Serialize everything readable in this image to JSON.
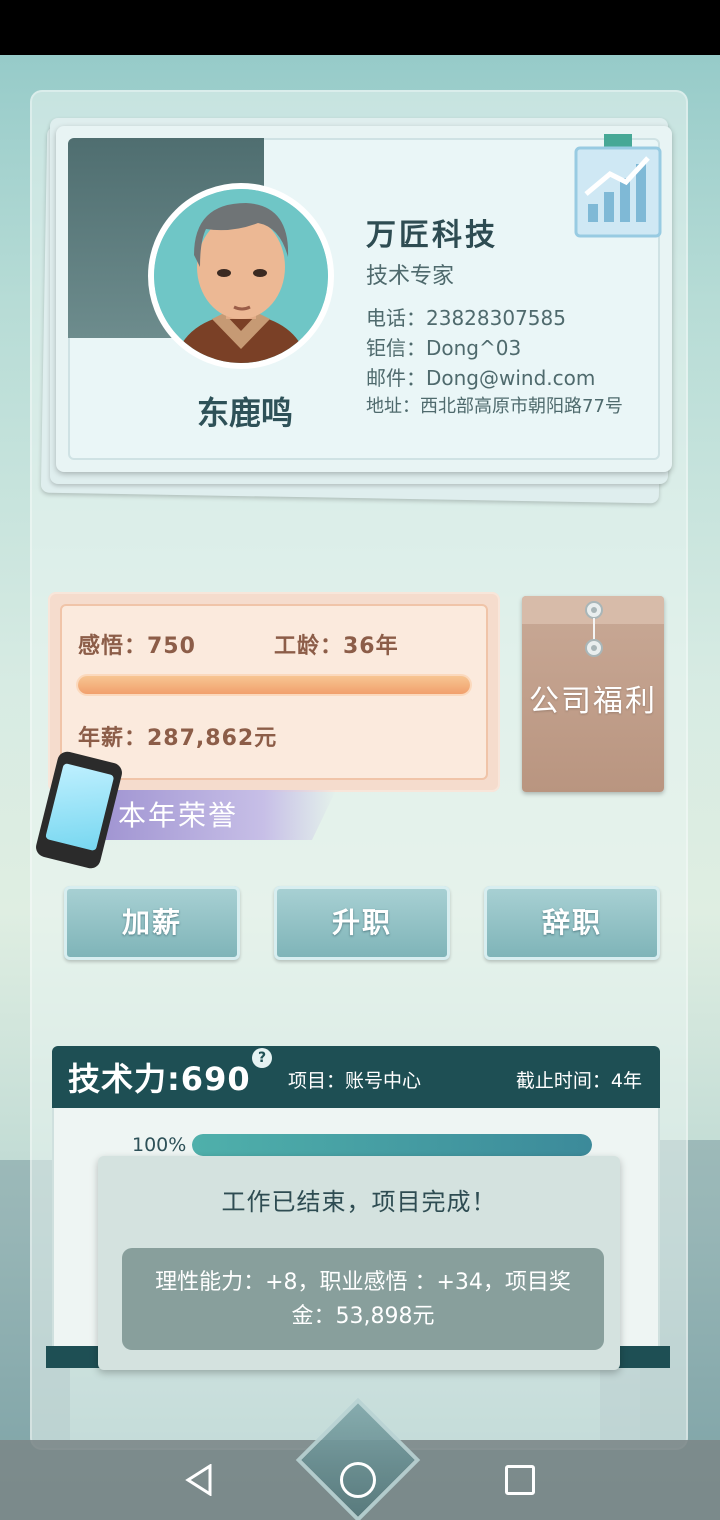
{
  "profile": {
    "name": "东鹿鸣",
    "company": "万匠科技",
    "title": "技术专家",
    "phone": "电话：23828307585",
    "messenger": "钜信：Dong^03",
    "email": "邮件：Dong@wind.com",
    "address": "地址：西北部高原市朝阳路77号"
  },
  "stats": {
    "insight": "感悟：750",
    "seniority": "工龄：36年",
    "salary": "年薪：287,862元",
    "progress": 1.0
  },
  "welfare": {
    "label": "公司福利"
  },
  "honor": {
    "label": "本年荣誉"
  },
  "actions": {
    "raise": "加薪",
    "promote": "升职",
    "resign": "辞职"
  },
  "tech": {
    "title": "技术力:690",
    "help": "?",
    "project": "项目：账号中心",
    "deadline": "截止时间：4年",
    "percent_label": "100%",
    "percent": 1.0
  },
  "popup": {
    "message": "工作已结束，项目完成！",
    "reward": "理性能力：+8，职业感悟 ：+34，项目奖金：53,898元"
  },
  "colors": {
    "header_dark": "#1e4f54",
    "accent_teal": "#4fb0ab",
    "stats_bg": "#fbeadd",
    "salary_bar": "#f1a06d"
  }
}
